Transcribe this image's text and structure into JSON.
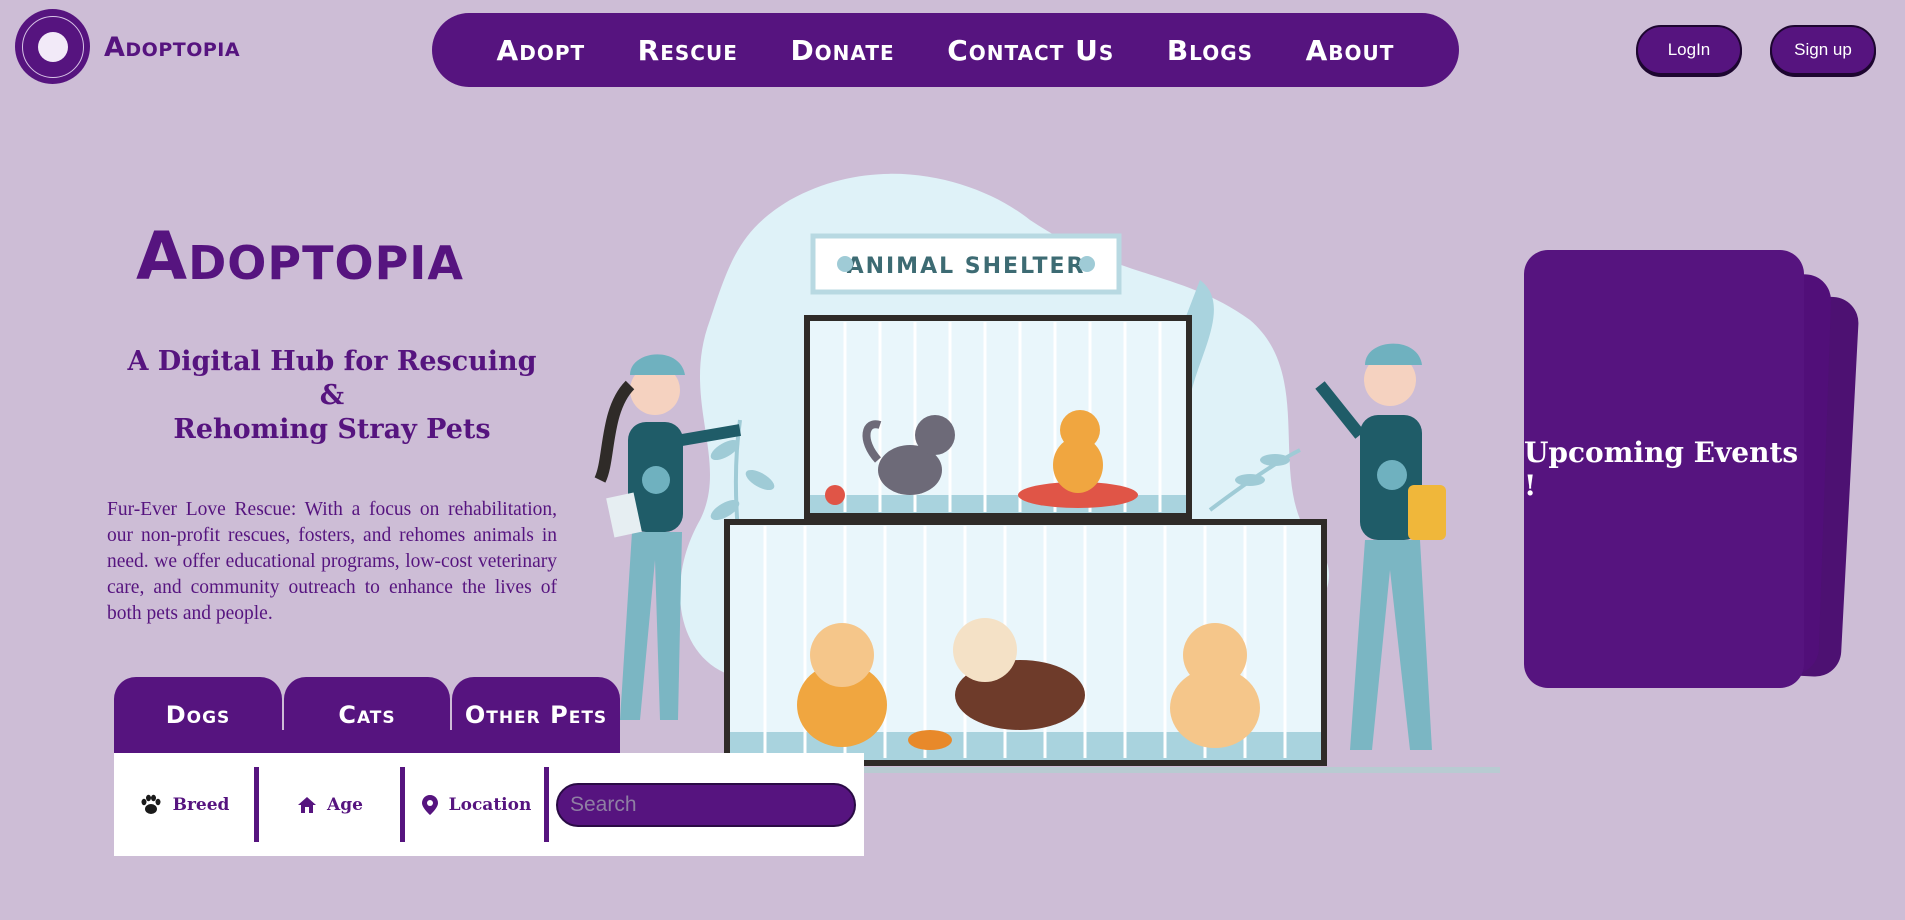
{
  "header": {
    "brand": "Adoptopia",
    "logo_text": "ADOPTOPIA",
    "nav": [
      {
        "label": "Adopt"
      },
      {
        "label": "Rescue"
      },
      {
        "label": "Donate"
      },
      {
        "label": "Contact Us"
      },
      {
        "label": "Blogs"
      },
      {
        "label": "About"
      }
    ],
    "login_label": "LogIn",
    "signup_label": "Sign up"
  },
  "hero": {
    "title": "Adoptopia",
    "tagline_line1": "A Digital Hub for Rescuing",
    "tagline_line2": "&",
    "tagline_line3": "Rehoming Stray Pets",
    "description": "Fur-Ever Love Rescue: With a focus on rehabilitation, our non-profit rescues, fosters, and rehomes animals in need. we offer educational programs, low-cost veterinary care, and community outreach to enhance the lives of both pets and people."
  },
  "tabs": [
    {
      "label": "Dogs"
    },
    {
      "label": "Cats"
    },
    {
      "label": "Other Pets"
    }
  ],
  "filters": {
    "breed": "Breed",
    "age": "Age",
    "location": "Location",
    "search_placeholder": "Search"
  },
  "illustration": {
    "sign_text": "ANIMAL SHELTER"
  },
  "events": {
    "title": "Upcoming Events !"
  },
  "colors": {
    "background": "#cdbdd6",
    "primary": "#56147f",
    "text_on_primary": "#ffffff"
  },
  "icons": {
    "breed": "paw-icon",
    "age": "home-icon",
    "location": "location-pin-icon"
  }
}
